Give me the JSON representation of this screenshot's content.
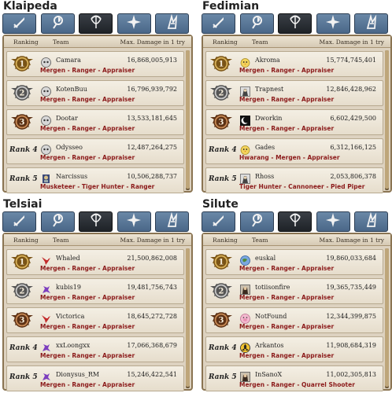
{
  "columns": {
    "ranking": "Ranking",
    "team": "Team",
    "max_damage": "Max. Damage in 1 try"
  },
  "tabs": [
    {
      "icon": "sword-icon",
      "active": false
    },
    {
      "icon": "mage-icon",
      "active": false
    },
    {
      "icon": "bow-icon",
      "active": true
    },
    {
      "icon": "cross-icon",
      "active": false
    },
    {
      "icon": "scout-icon",
      "active": false
    }
  ],
  "servers": [
    {
      "name": "Klaipeda",
      "rows": [
        {
          "rank": 1,
          "rank_label": "",
          "medal": "gold",
          "icon": "ghost",
          "team": "Camara",
          "damage": "16,868,005,913",
          "classes": "Mergen - Ranger - Appraiser"
        },
        {
          "rank": 2,
          "rank_label": "",
          "medal": "silver",
          "icon": "ghost",
          "team": "KotenBuu",
          "damage": "16,796,939,792",
          "classes": "Mergen - Ranger - Appraiser"
        },
        {
          "rank": 3,
          "rank_label": "",
          "medal": "bronze",
          "icon": "ghost",
          "team": "Dootar",
          "damage": "13,533,181,645",
          "classes": "Mergen - Ranger - Appraiser"
        },
        {
          "rank": 4,
          "rank_label": "Rank 4",
          "medal": "",
          "icon": "ghost",
          "team": "Odysseo",
          "damage": "12,487,264,275",
          "classes": "Mergen - Ranger - Appraiser"
        },
        {
          "rank": 5,
          "rank_label": "Rank 5",
          "medal": "",
          "icon": "knight",
          "team": "Narcissus",
          "damage": "10,506,288,737",
          "classes": "Musketeer - Tiger Hunter - Ranger"
        }
      ]
    },
    {
      "name": "Fedimian",
      "rows": [
        {
          "rank": 1,
          "rank_label": "",
          "medal": "gold",
          "icon": "chick",
          "team": "Akroma",
          "damage": "15,774,745,401",
          "classes": "Mergen - Ranger - Appraiser"
        },
        {
          "rank": 2,
          "rank_label": "",
          "medal": "silver",
          "icon": "portrait",
          "team": "Trapnest",
          "damage": "12,846,428,962",
          "classes": "Mergen - Ranger - Appraiser"
        },
        {
          "rank": 3,
          "rank_label": "",
          "medal": "bronze",
          "icon": "moon",
          "team": "Dworkin",
          "damage": "6,602,429,500",
          "classes": "Mergen - Ranger - Appraiser"
        },
        {
          "rank": 4,
          "rank_label": "Rank 4",
          "medal": "",
          "icon": "chick",
          "team": "Gades",
          "damage": "6,312,166,125",
          "classes": "Hwarang - Mergen - Appraiser"
        },
        {
          "rank": 5,
          "rank_label": "Rank 5",
          "medal": "",
          "icon": "portrait",
          "team": "Rhoss",
          "damage": "2,053,806,378",
          "classes": "Tiger Hunter - Cannoneer - Pied Piper"
        }
      ]
    },
    {
      "name": "Telsiai",
      "rows": [
        {
          "rank": 1,
          "rank_label": "",
          "medal": "gold",
          "icon": "bird-red",
          "team": "Whaled",
          "damage": "21,500,862,008",
          "classes": "Mergen - Ranger - Appraiser"
        },
        {
          "rank": 2,
          "rank_label": "",
          "medal": "silver",
          "icon": "dragon-purple",
          "team": "kubis19",
          "damage": "19,481,756,743",
          "classes": "Mergen - Ranger - Appraiser"
        },
        {
          "rank": 3,
          "rank_label": "",
          "medal": "bronze",
          "icon": "bird-red",
          "team": "Victorica",
          "damage": "18,645,272,728",
          "classes": "Mergen - Ranger - Appraiser"
        },
        {
          "rank": 4,
          "rank_label": "Rank 4",
          "medal": "",
          "icon": "dragon-purple",
          "team": "xxLoongxx",
          "damage": "17,066,368,679",
          "classes": "Mergen - Ranger - Appraiser"
        },
        {
          "rank": 5,
          "rank_label": "Rank 5",
          "medal": "",
          "icon": "dragon-purple",
          "team": "Dionysus_RM",
          "damage": "15,246,422,541",
          "classes": "Mergen - Ranger - Appraiser"
        }
      ]
    },
    {
      "name": "Silute",
      "rows": [
        {
          "rank": 1,
          "rank_label": "",
          "medal": "gold",
          "icon": "globe",
          "team": "euskal",
          "damage": "19,860,033,684",
          "classes": "Mergen - Ranger - Appraiser"
        },
        {
          "rank": 2,
          "rank_label": "",
          "medal": "silver",
          "icon": "portrait-dark",
          "team": "totiisonfire",
          "damage": "19,365,735,449",
          "classes": "Mergen - Ranger - Appraiser"
        },
        {
          "rank": 3,
          "rank_label": "",
          "medal": "bronze",
          "icon": "pig",
          "team": "NotFound",
          "damage": "12,344,399,875",
          "classes": "Mergen - Ranger - Appraiser"
        },
        {
          "rank": 4,
          "rank_label": "Rank 4",
          "medal": "",
          "icon": "hazard",
          "team": "Arkantos",
          "damage": "11,908,684,319",
          "classes": "Mergen - Ranger - Appraiser"
        },
        {
          "rank": 5,
          "rank_label": "Rank 5",
          "medal": "",
          "icon": "portrait-dark",
          "team": "InSanoX",
          "damage": "11,002,305,813",
          "classes": "Mergen - Ranger - Quarrel Shooter"
        }
      ]
    }
  ]
}
